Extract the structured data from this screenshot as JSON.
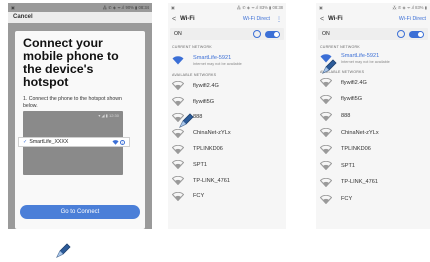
{
  "colors": {
    "accent": "#3b6fd6",
    "button": "#4b7fd8",
    "dim": "#9a9a9a"
  },
  "screen1": {
    "status_left": "▣",
    "status_right": "⁂ ✆ ◈ ᯤ.ıl 90% ▮ 08:34",
    "cancel": "Cancel",
    "title": "Connect your mobile phone to the device's hotspot",
    "step": "1. Connect the phone to the hotspot shown below.",
    "mock_status": "▾ ◢ ▮ 12:30",
    "hotspot_name": "SmartLife_XXXX",
    "connect_button": "Go to Connect"
  },
  "screen2": {
    "status_left": "▣",
    "status_right": "⁂ ✆ ◈ ᯤ.ıl 83% ▮ 08:38",
    "back": "<",
    "title": "Wi-Fi",
    "wifi_direct": "Wi-Fi Direct",
    "more": "⋮",
    "toggle_label": "ON",
    "current_header": "CURRENT NETWORK",
    "current": {
      "name": "SmartLife-5921",
      "sub": "Internet may not be available"
    },
    "available_header": "AVAILABLE NETWORKS",
    "networks": [
      "flywifi2.4G",
      "flywifi5G",
      "888",
      "ChinaNet-zYLx",
      "TPLINKD06",
      "SPT1",
      "TP-LINK_4761",
      "FCY"
    ]
  },
  "screen3": {
    "status_left": "▣",
    "status_right": "⁂ ✆ ◈ ᯤ.ıl 83% ▮",
    "back": "<",
    "title": "Wi-Fi",
    "wifi_direct": "Wi-Fi Direct",
    "toggle_label": "ON",
    "current_header": "CURRENT NETWORK",
    "current": {
      "name": "SmartLife-5921",
      "sub": "Internet may not be available"
    },
    "available_header": "AVAILABLE NETWORKS",
    "networks": [
      "flywifi2.4G",
      "flywifi5G",
      "888",
      "ChinaNet-zYLx",
      "TPLINKD06",
      "SPT1",
      "TP-LINK_4761",
      "FCY"
    ]
  }
}
